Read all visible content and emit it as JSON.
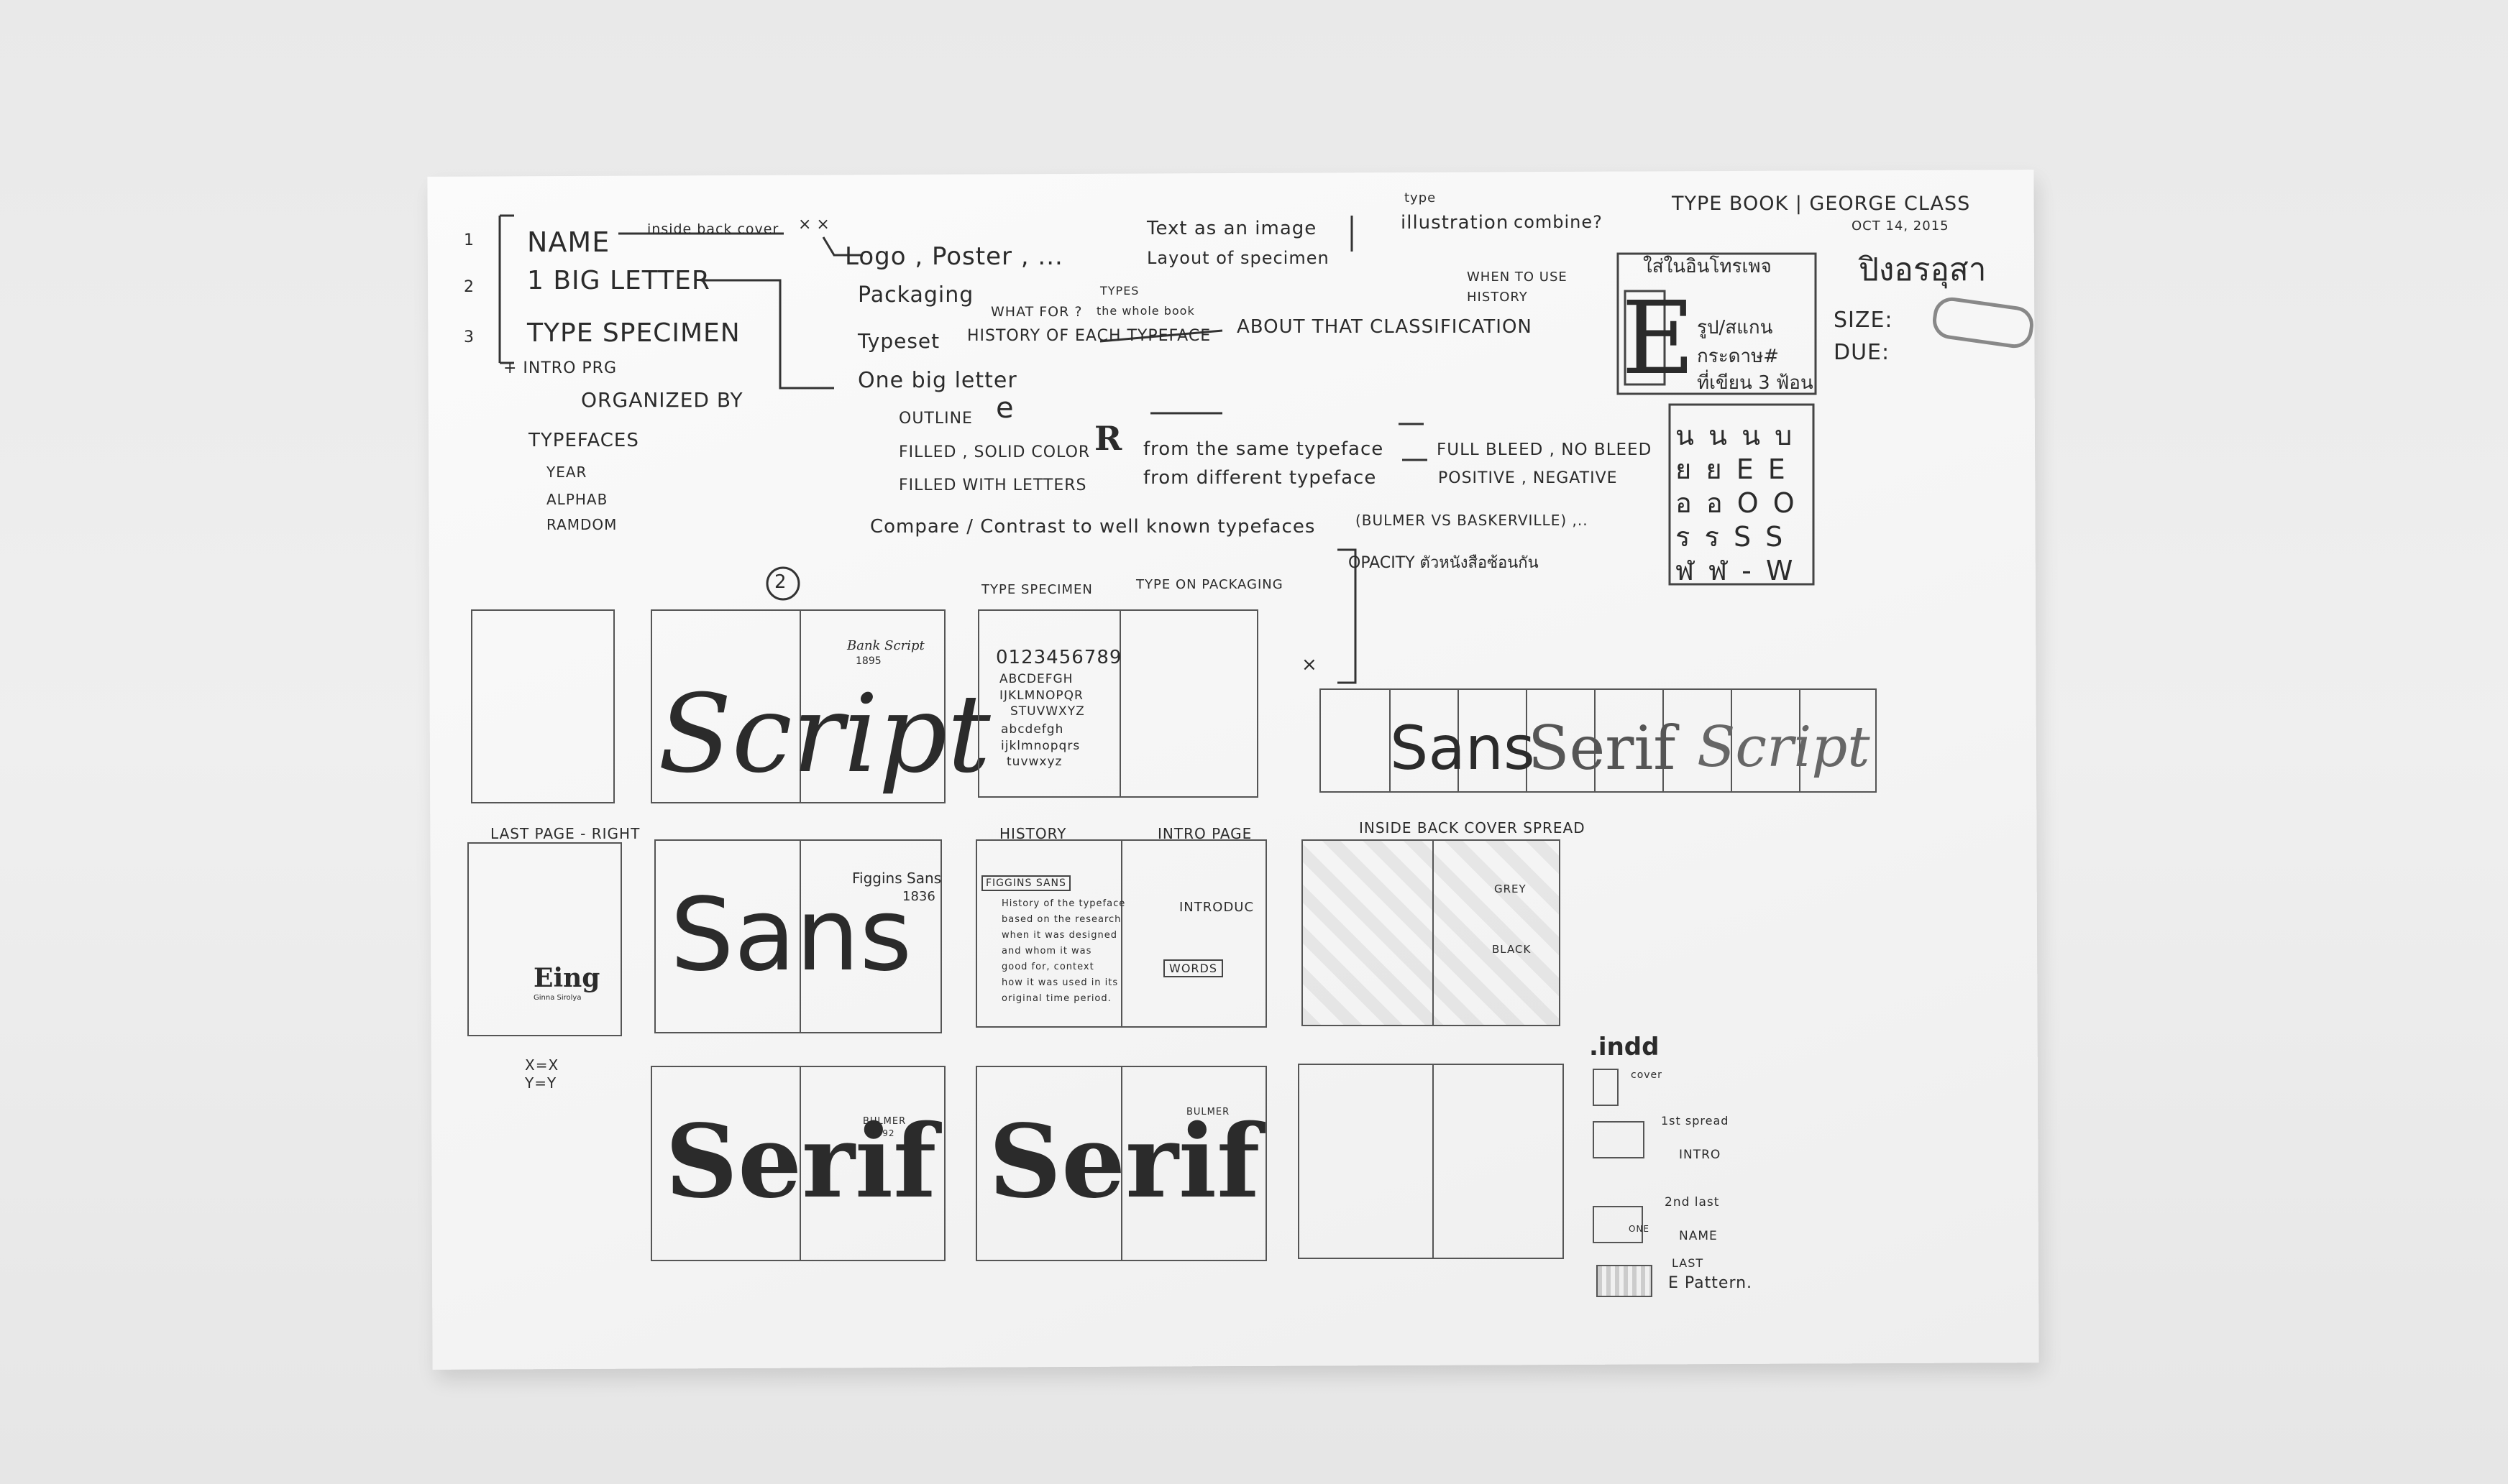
{
  "header": {
    "title": "TYPE BOOK | GEORGE CLASS",
    "date": "OCT 14, 2015",
    "name_thai": "ปิงอรอุสา",
    "size_label": "SIZE:",
    "due_label": "DUE:"
  },
  "plan": {
    "items": [
      {
        "num": "1",
        "label": "NAME",
        "note": "inside back cover"
      },
      {
        "num": "2",
        "label": "1 BIG LETTER"
      },
      {
        "num": "3",
        "label": "TYPE SPECIMEN"
      }
    ],
    "intro": "+ INTRO PRG",
    "organized_by": "ORGANIZED BY",
    "typefaces": "TYPEFACES",
    "sub_list": [
      "YEAR",
      "ALPHAB",
      "RAMDOM"
    ],
    "xx": "× ×"
  },
  "ideas": {
    "logo_poster": "Logo , Poster , ...",
    "packaging": "Packaging",
    "what_for": "WHAT FOR ?",
    "types": "TYPES",
    "whole_book": "the whole book",
    "typeset": "Typeset",
    "history_each": "HISTORY OF EACH TYPEFACE",
    "about_classification": "ABOUT THAT CLASSIFICATION",
    "when_to_use": "WHEN TO USE",
    "history": "HISTORY",
    "one_big_letter": "One big letter",
    "outline": "OUTLINE",
    "filled_solid": "FILLED , SOLID COLOR",
    "filled_letters": "FILLED WITH LETTERS",
    "same_typeface": "from the same typeface",
    "diff_typeface": "from different typeface",
    "full_bleed": "FULL BLEED , NO BLEED",
    "positive": "POSITIVE , NEGATIVE",
    "compare": "Compare / Contrast to well known typefaces",
    "bulmer_vs": "(BULMER VS BASKERVILLE) ,..",
    "text_image": "Text as an image",
    "layout_specimen": "Layout of specimen",
    "type_illus": "type",
    "illustration": "illustration",
    "combine": "combine?",
    "glyph_e": "e",
    "glyph_r": "R"
  },
  "thai_box": {
    "title": "ใส่ในอินโทรเพจ",
    "lines": [
      "รูป/สแกน",
      "กระดาษ#",
      "ที่เขียน 3 ฟ้อน"
    ],
    "big_e": "E",
    "grid": [
      "น น น บ",
      "ย ย E E",
      "อ อ O O",
      "ร ร S S",
      "ฬ ฬ - W"
    ]
  },
  "sketches": {
    "circle_two": "2",
    "type_specimen": "TYPE SPECIMEN",
    "type_packaging": "TYPE ON PACKAGING",
    "opacity_note": "OPACITY ตัวหนังสือซ้อนกัน",
    "specimen_lines": [
      "0123456789",
      "ABCDEFGH",
      "IJKLMNOPQR",
      "STUVWXYZ",
      "abcdefgh",
      "ijklmnopqrs",
      "tuvwxyz"
    ],
    "script_word": "Script",
    "bank_script": "Bank Script",
    "bank_year": "1895",
    "sans_serif_strip": [
      "Sans",
      "Serif",
      "Script"
    ],
    "last_page_right": "LAST PAGE - RIGHT",
    "eing": "Eing",
    "eing_sub": "Ginna Sirolya",
    "xy": [
      "X=X",
      "Y=Y"
    ],
    "sans_word": "Sans",
    "figgins_sans": "Figgins Sans",
    "figgins_year": "1836",
    "history_label": "HISTORY",
    "intro_page": "INTRO PAGE",
    "figgins_tag": "FIGGINS SANS",
    "history_text": [
      "History of the typeface",
      "based on the research",
      "when it was designed",
      "and whom it was",
      "good for, context",
      "how it was used in its",
      "original time period."
    ],
    "introduc": "INTRODUC",
    "words": "WORDS",
    "inside_back": "INSIDE BACK COVER SPREAD",
    "grey": "GREY",
    "black": "BLACK",
    "serif_word": "Serif",
    "bulmer": "BULMER",
    "bulmer_year": "1792",
    "x_mark": "×"
  },
  "indd": {
    "title": ".indd",
    "cover": "cover",
    "first_spread": "1st spread",
    "intro": "INTRO",
    "second_last": "2nd last",
    "name": "NAME",
    "one_e": "ONE",
    "last": "LAST",
    "pattern": "E Pattern."
  }
}
